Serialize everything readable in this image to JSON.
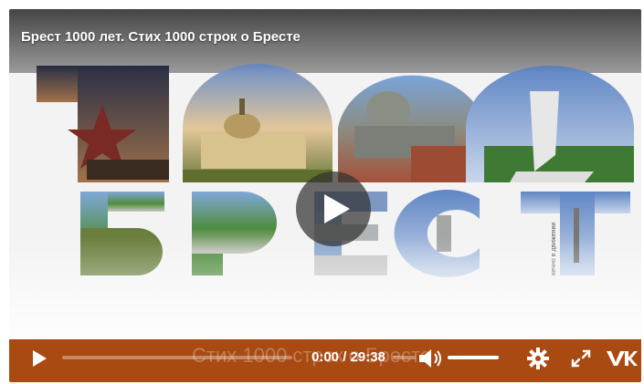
{
  "video": {
    "title": "Брест 1000 лет. Стих 1000 строк о Бресте",
    "poster_number": "1000",
    "poster_word": "БРЕСТ",
    "poster_vertical_text": "вечно в движении",
    "subtitle_ghost": "Стих 1000 строк о Бресте"
  },
  "controls": {
    "time": "0:00 / 29:38",
    "progress_fraction": 0,
    "volume_fraction": 1.0
  },
  "icons": {
    "play": "play-icon",
    "big_play": "big-play-icon",
    "volume": "volume-icon",
    "settings": "gear-icon",
    "fullscreen": "fullscreen-icon",
    "brand": "vk-logo-icon"
  },
  "colors": {
    "control_bar": "#a84a12",
    "accent": "#ffffff"
  }
}
